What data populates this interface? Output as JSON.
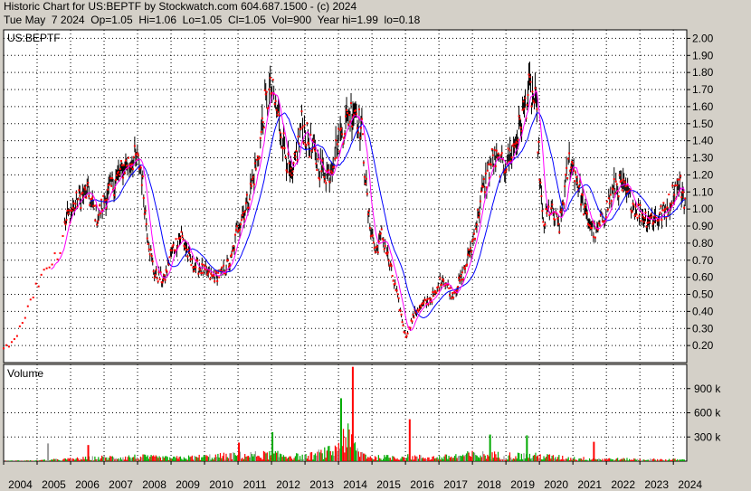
{
  "header": {
    "line1": "Historic Chart for US:BEPTF by Stockwatch.com 604.687.1500 - (c) 2024",
    "line2": "Tue May  7 2024  Op=1.05  Hi=1.06  Lo=1.05  Cl=1.05  Vol=900  Year hi=1.99  lo=0.18"
  },
  "colors": {
    "background": "#d4d0c8",
    "plot_bg": "#ffffff",
    "grid": "#000000",
    "price_bars": "#000000",
    "close_dots": "#ff0000",
    "short_ma": "#ff00ff",
    "long_ma": "#0000ff",
    "vol_up": "#00aa00",
    "vol_down": "#ff0000",
    "vol_neutral": "#999999"
  },
  "chart_data": {
    "type": "line",
    "symbol_label": "US:BEPTF",
    "volume_label": "Volume",
    "x_tick_labels": [
      "2004",
      "2005",
      "2006",
      "2007",
      "2008",
      "2009",
      "2010",
      "2011",
      "2012",
      "2013",
      "2014",
      "2015",
      "2016",
      "2017",
      "2018",
      "2019",
      "2020",
      "2021",
      "2022",
      "2023",
      "2024"
    ],
    "xlim": [
      2004.0,
      2024.4
    ],
    "price_axis": {
      "ylim": [
        0.1,
        2.05
      ],
      "ticks": [
        "2.00",
        "1.90",
        "1.80",
        "1.70",
        "1.60",
        "1.50",
        "1.40",
        "1.30",
        "1.20",
        "1.10",
        "1.00",
        "0.90",
        "0.80",
        "0.70",
        "0.60",
        "0.50",
        "0.40",
        "0.30",
        "0.20"
      ]
    },
    "volume_axis": {
      "ylim": [
        0,
        1200000
      ],
      "ticks": [
        {
          "value": 900000,
          "label": "900 k"
        },
        {
          "value": 600000,
          "label": "600 k"
        },
        {
          "value": 300000,
          "label": "300 k"
        }
      ]
    },
    "price_anchors": {
      "x": [
        2004.0,
        2004.3,
        2004.6,
        2005.0,
        2005.3,
        2005.6,
        2005.9,
        2006.2,
        2006.5,
        2006.8,
        2007.0,
        2007.3,
        2007.6,
        2007.9,
        2008.1,
        2008.3,
        2008.5,
        2008.8,
        2009.0,
        2009.3,
        2009.6,
        2009.9,
        2010.2,
        2010.5,
        2010.8,
        2011.0,
        2011.3,
        2011.6,
        2011.8,
        2012.0,
        2012.3,
        2012.6,
        2012.9,
        2013.1,
        2013.4,
        2013.7,
        2014.0,
        2014.3,
        2014.5,
        2014.7,
        2014.9,
        2015.1,
        2015.3,
        2015.5,
        2015.8,
        2016.0,
        2016.3,
        2016.6,
        2016.9,
        2017.1,
        2017.4,
        2017.7,
        2018.0,
        2018.3,
        2018.6,
        2018.9,
        2019.1,
        2019.3,
        2019.5,
        2019.7,
        2019.9,
        2020.1,
        2020.3,
        2020.6,
        2020.9,
        2021.1,
        2021.4,
        2021.7,
        2022.0,
        2022.3,
        2022.6,
        2022.9,
        2023.2,
        2023.5,
        2023.8,
        2024.0,
        2024.2,
        2024.35
      ],
      "y": [
        0.18,
        0.22,
        0.35,
        0.55,
        0.65,
        0.72,
        0.95,
        1.05,
        1.1,
        0.95,
        1.05,
        1.15,
        1.25,
        1.3,
        1.25,
        0.85,
        0.62,
        0.58,
        0.75,
        0.85,
        0.68,
        0.65,
        0.6,
        0.62,
        0.7,
        0.9,
        1.05,
        1.3,
        1.6,
        1.7,
        1.45,
        1.15,
        1.5,
        1.4,
        1.25,
        1.2,
        1.4,
        1.55,
        1.6,
        1.45,
        0.95,
        0.75,
        0.85,
        0.7,
        0.45,
        0.25,
        0.4,
        0.45,
        0.5,
        0.6,
        0.5,
        0.6,
        0.8,
        1.1,
        1.3,
        1.25,
        1.3,
        1.4,
        1.55,
        1.7,
        1.6,
        0.9,
        1.0,
        0.9,
        1.3,
        1.2,
        0.95,
        0.85,
        1.0,
        1.15,
        1.1,
        1.0,
        0.95,
        0.95,
        1.0,
        1.1,
        1.15,
        1.05
      ]
    },
    "volume_anchors": {
      "x": [
        2004.0,
        2005.0,
        2006.0,
        2007.0,
        2008.0,
        2009.0,
        2010.0,
        2011.0,
        2012.0,
        2013.0,
        2013.9,
        2014.1,
        2014.3,
        2014.6,
        2015.0,
        2016.0,
        2017.0,
        2018.0,
        2019.0,
        2020.0,
        2021.0,
        2022.0,
        2023.0,
        2024.3
      ],
      "y": [
        5000,
        10000,
        30000,
        50000,
        60000,
        40000,
        60000,
        80000,
        90000,
        60000,
        150000,
        380000,
        300000,
        120000,
        50000,
        60000,
        50000,
        90000,
        80000,
        70000,
        40000,
        30000,
        25000,
        20000
      ]
    },
    "highlighted_volume_spikes": [
      {
        "x": 2005.3,
        "value": 220000,
        "dir": "neutral"
      },
      {
        "x": 2006.5,
        "value": 200000,
        "dir": "down"
      },
      {
        "x": 2011.0,
        "value": 230000,
        "dir": "down"
      },
      {
        "x": 2012.0,
        "value": 360000,
        "dir": "up"
      },
      {
        "x": 2014.05,
        "value": 780000,
        "dir": "up"
      },
      {
        "x": 2014.4,
        "value": 1170000,
        "dir": "down"
      },
      {
        "x": 2016.1,
        "value": 520000,
        "dir": "down"
      },
      {
        "x": 2018.5,
        "value": 330000,
        "dir": "up"
      },
      {
        "x": 2019.6,
        "value": 320000,
        "dir": "up"
      },
      {
        "x": 2021.6,
        "value": 240000,
        "dir": "down"
      }
    ]
  }
}
